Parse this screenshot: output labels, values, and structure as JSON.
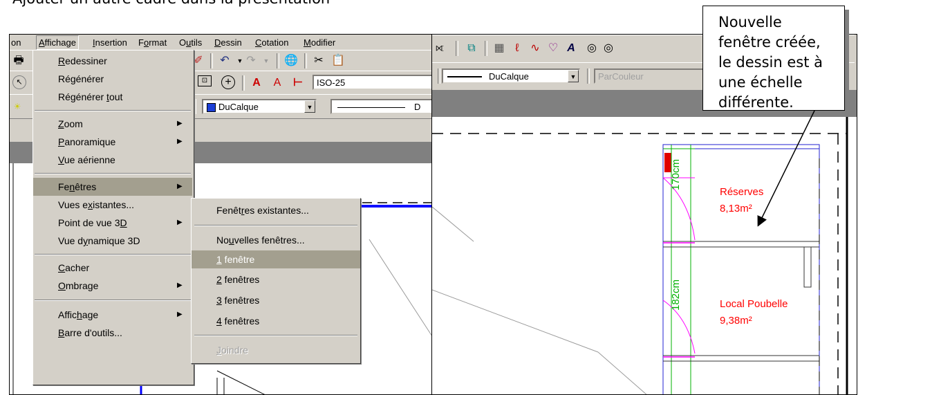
{
  "heading": "Ajouter un autre cadre dans la présentation",
  "left_window": {
    "menubar": [
      "on",
      "Affichage",
      "Insertion",
      "Format",
      "Outils",
      "Dessin",
      "Cotation",
      "Modifier"
    ],
    "active_menu": "Affichage",
    "toolbar": {
      "dimstyle": "ISO-25",
      "color": "DuCalque",
      "linetype": "D"
    },
    "affichage_menu": [
      {
        "label": "Redessiner"
      },
      {
        "label": "Régénérer"
      },
      {
        "label": "Régénérer tout"
      },
      {
        "label": "Zoom",
        "submenu": true
      },
      {
        "label": "Panoramique",
        "submenu": true
      },
      {
        "label": "Vue aérienne"
      },
      {
        "label": "Fenêtres",
        "submenu": true,
        "highlighted": true
      },
      {
        "label": "Vues existantes..."
      },
      {
        "label": "Point de vue 3D",
        "submenu": true
      },
      {
        "label": "Vue dynamique 3D"
      },
      {
        "label": "Cacher"
      },
      {
        "label": "Ombrage",
        "submenu": true
      },
      {
        "label": "Affichage",
        "submenu": true
      },
      {
        "label": "Barre d'outils..."
      }
    ],
    "fenetres_submenu": [
      {
        "label": "Fenêtres existantes..."
      },
      {
        "label": "Nouvelles fenêtres..."
      },
      {
        "label": "1 fenêtre",
        "highlighted": true
      },
      {
        "label": "2 fenêtres"
      },
      {
        "label": "3 fenêtres"
      },
      {
        "label": "4 fenêtres"
      },
      {
        "label": "Joindre",
        "disabled": true
      }
    ]
  },
  "right_window": {
    "toolbar": {
      "linetype": "DuCalque",
      "plotstyle": "ParCouleur"
    },
    "drawing": {
      "dim1": "170cm",
      "dim2": "182cm",
      "room1_name": "Réserves",
      "room1_area": "8,13m²",
      "room2_name": "Local Poubelle",
      "room2_area": "9,38m²"
    }
  },
  "callout": {
    "text": "Nouvelle fenêtre créée, le dessin est à une échelle différente."
  },
  "colors": {
    "ui_gray": "#d4d0c8",
    "menu_highlight": "#a39f8f",
    "room_text": "#ff0000",
    "plan_blue": "#0000cc",
    "plan_green": "#00c000",
    "plan_magenta": "#ff00ff"
  }
}
